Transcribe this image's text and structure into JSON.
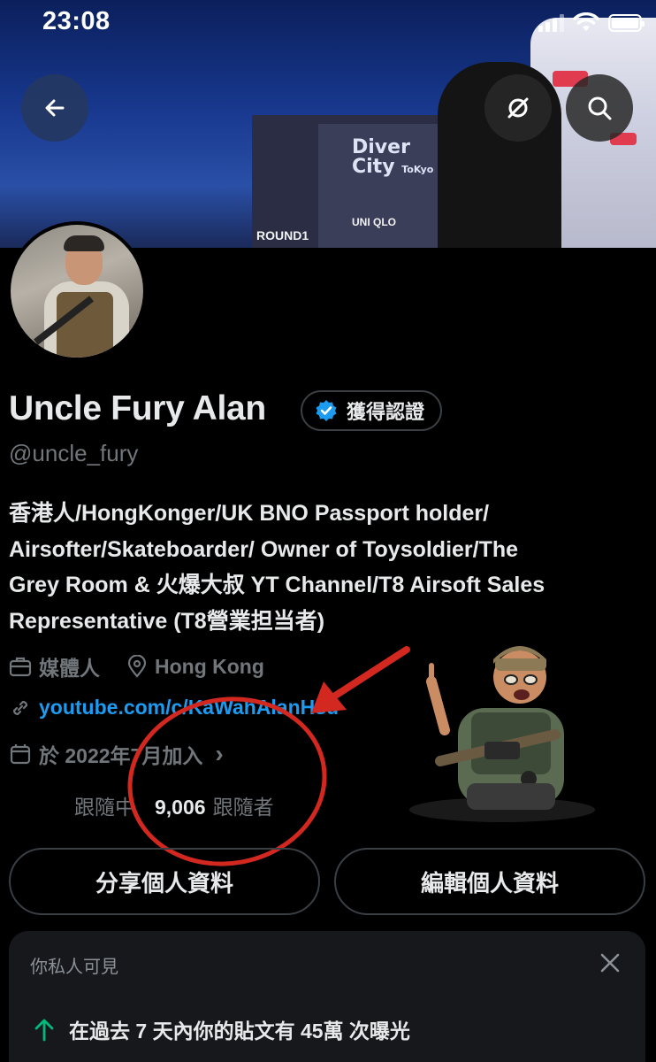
{
  "status_bar": {
    "time": "23:08"
  },
  "banner": {
    "sign_diver": "Diver",
    "sign_city": "City",
    "sign_tokyo": "ToKyo",
    "sign_round1": "ROUND1",
    "sign_uniqlo": "UNI QLO"
  },
  "profile": {
    "display_name": "Uncle Fury Alan",
    "verified_label": "獲得認證",
    "handle": "@uncle_fury",
    "bio_lines": [
      "香港人/HongKonger/UK BNO Passport holder/",
      "Airsofter/Skateboarder/ Owner of Toysoldier/The",
      "Grey Room & 火爆大叔 YT Channel/T8 Airsoft Sales",
      "Representative (T8營業担当者)"
    ],
    "category": "媒體人",
    "location": "Hong Kong",
    "website": "youtube.com/c/KaWahAlanHsu",
    "joined": "於 2022年7月加入",
    "joined_chevron": "›",
    "following_label": "跟隨中",
    "followers_count": "9,006",
    "followers_label": "跟隨者"
  },
  "actions": {
    "share_label": "分享個人資料",
    "edit_label": "編輯個人資料"
  },
  "private_card": {
    "title": "你私人可見",
    "impression_text": "在過去 7 天內你的貼文有 45萬 次曝光"
  },
  "colors": {
    "background": "#000000",
    "text_primary": "#e7e9ea",
    "text_secondary": "#71767b",
    "link": "#1d9bf0",
    "verified": "#1d9bf0",
    "annotation_red": "#d2281f",
    "impression_up": "#00ba7c"
  },
  "icons": [
    "back-arrow-icon",
    "mute-icon",
    "search-icon",
    "verified-badge-icon",
    "briefcase-icon",
    "location-pin-icon",
    "link-icon",
    "calendar-icon",
    "close-icon",
    "arrow-up-icon"
  ]
}
